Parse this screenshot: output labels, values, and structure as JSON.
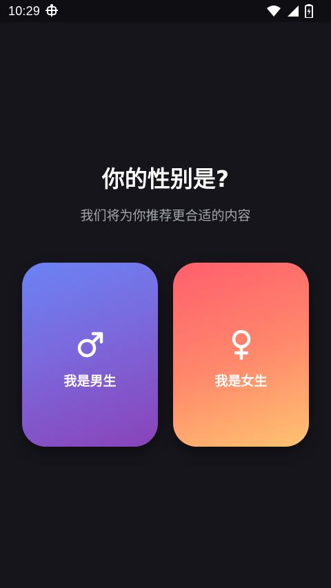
{
  "status_bar": {
    "time": "10:29",
    "app_icon": "bug-icon",
    "icons": [
      "wifi-icon",
      "cell-signal-icon",
      "battery-charging-icon"
    ]
  },
  "main": {
    "title": "你的性别是?",
    "subtitle": "我们将为你推荐更合适的内容"
  },
  "options": {
    "male": {
      "icon": "male-symbol-icon",
      "label": "我是男生",
      "gradient": [
        "#6b83f4",
        "#8a43b8"
      ]
    },
    "female": {
      "icon": "female-symbol-icon",
      "label": "我是女生",
      "gradient": [
        "#ff5f6d",
        "#ffc371"
      ]
    }
  },
  "colors": {
    "background": "#15151b",
    "title": "#ffffff",
    "subtitle": "#a5a5ad"
  }
}
